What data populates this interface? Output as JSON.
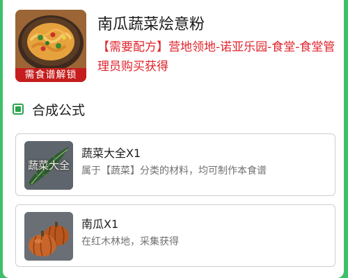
{
  "recipe": {
    "title": "南瓜蔬菜烩意粉",
    "source_text": "【需要配方】营地领地-诺亚乐园-食堂-食堂管理员购买获得",
    "unlock_badge": "需食谱解锁",
    "image_icon": "vegetable-pasta-dish-icon"
  },
  "section": {
    "title": "合成公式",
    "icon": "square-bullet-icon"
  },
  "ingredients": [
    {
      "name": "蔬菜大全X1",
      "description": "属于【蔬菜】分类的材料，均可制作本食谱",
      "thumb_label": "蔬菜大全",
      "icon": "leafy-vegetable-icon"
    },
    {
      "name": "南瓜X1",
      "description": "在红木林地，采集获得",
      "icon": "pumpkin-icon"
    }
  ],
  "colors": {
    "background_green": "#3ec06a",
    "accent_red": "#e0232b",
    "badge_red": "#c51d1d",
    "section_green": "#2aa54e"
  }
}
